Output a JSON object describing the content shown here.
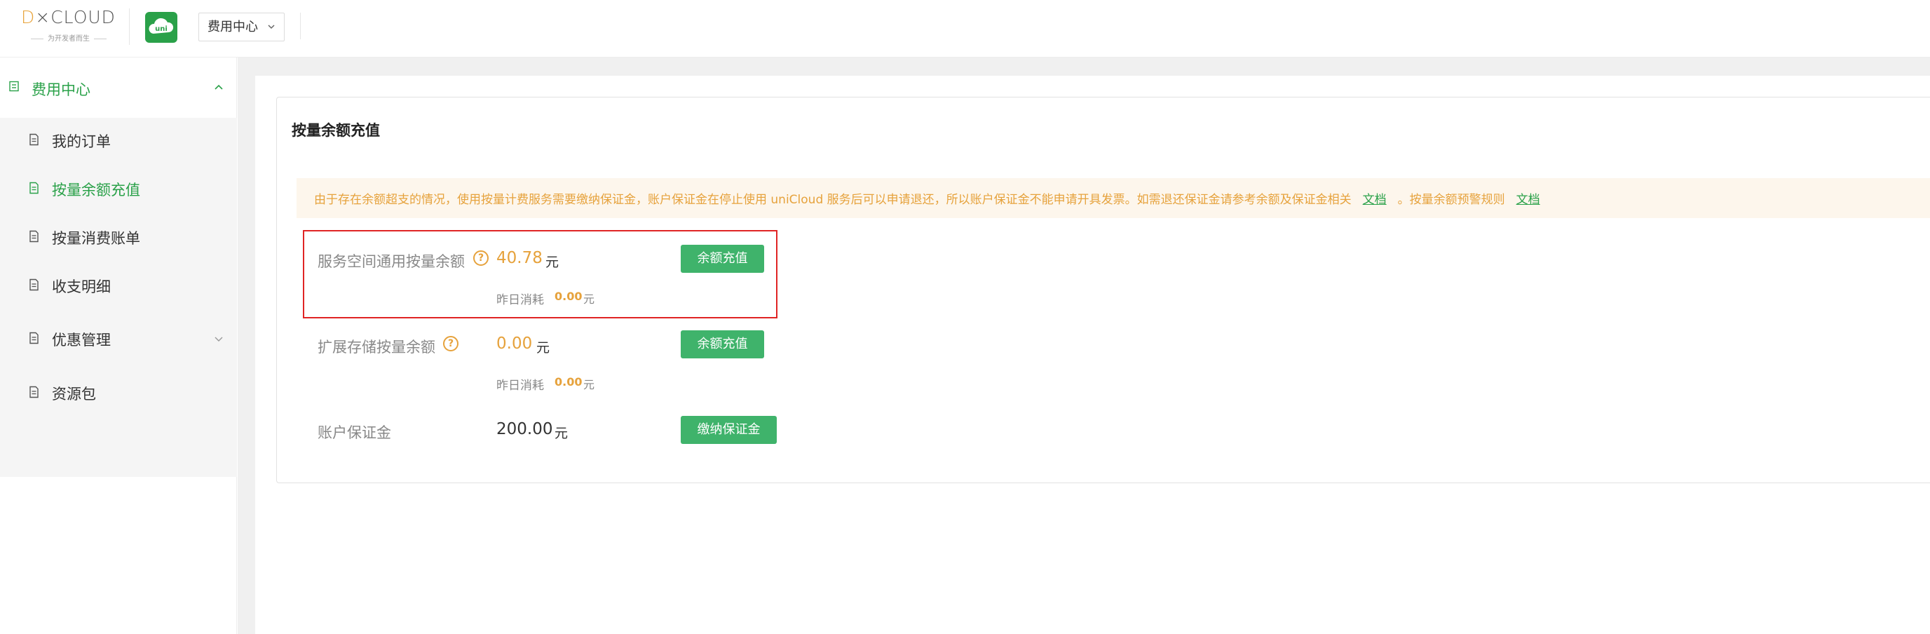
{
  "header": {
    "logo_text": "DCLOUD",
    "logo_slogan": "为开发者而生",
    "app_icon_text": "uni",
    "app_selector": "费用中心"
  },
  "sidebar": {
    "group": {
      "label": "费用中心",
      "expanded": true
    },
    "items": [
      {
        "label": "我的订单",
        "active": false
      },
      {
        "label": "按量余额充值",
        "active": true
      },
      {
        "label": "按量消费账单",
        "active": false
      },
      {
        "label": "收支明细",
        "active": false
      },
      {
        "label": "优惠管理",
        "active": false,
        "has_children": true
      },
      {
        "label": "资源包",
        "active": false
      }
    ]
  },
  "main": {
    "title": "按量余额充值",
    "notice": {
      "text": "由于存在余额超支的情况，使用按量计费服务需要缴纳保证金，账户保证金在停止使用 uniCloud 服务后可以申请退还，所以账户保证金不能申请开具发票。如需退还保证金请参考余额及保证金相关",
      "link1": "文档",
      "text2": "。按量余额预警规则",
      "link2": "文档"
    },
    "rows": [
      {
        "label": "服务空间通用按量余额",
        "amount": "40.78",
        "unit": "元",
        "yesterday_label": "昨日消耗",
        "yesterday_value": "0.00",
        "yesterday_unit": "元",
        "button": "余额充值"
      },
      {
        "label": "扩展存储按量余额",
        "amount": "0.00",
        "unit": "元",
        "yesterday_label": "昨日消耗",
        "yesterday_value": "0.00",
        "yesterday_unit": "元",
        "button": "余额充值"
      },
      {
        "label": "账户保证金",
        "amount": "200.00",
        "unit": "元",
        "button": "缴纳保证金"
      }
    ]
  },
  "colors": {
    "brand_green": "#2aa149",
    "button_green": "#3fb36b",
    "accent_orange": "#e6a23c",
    "highlight_red": "#e02424",
    "notice_bg": "#fdf6ec"
  }
}
